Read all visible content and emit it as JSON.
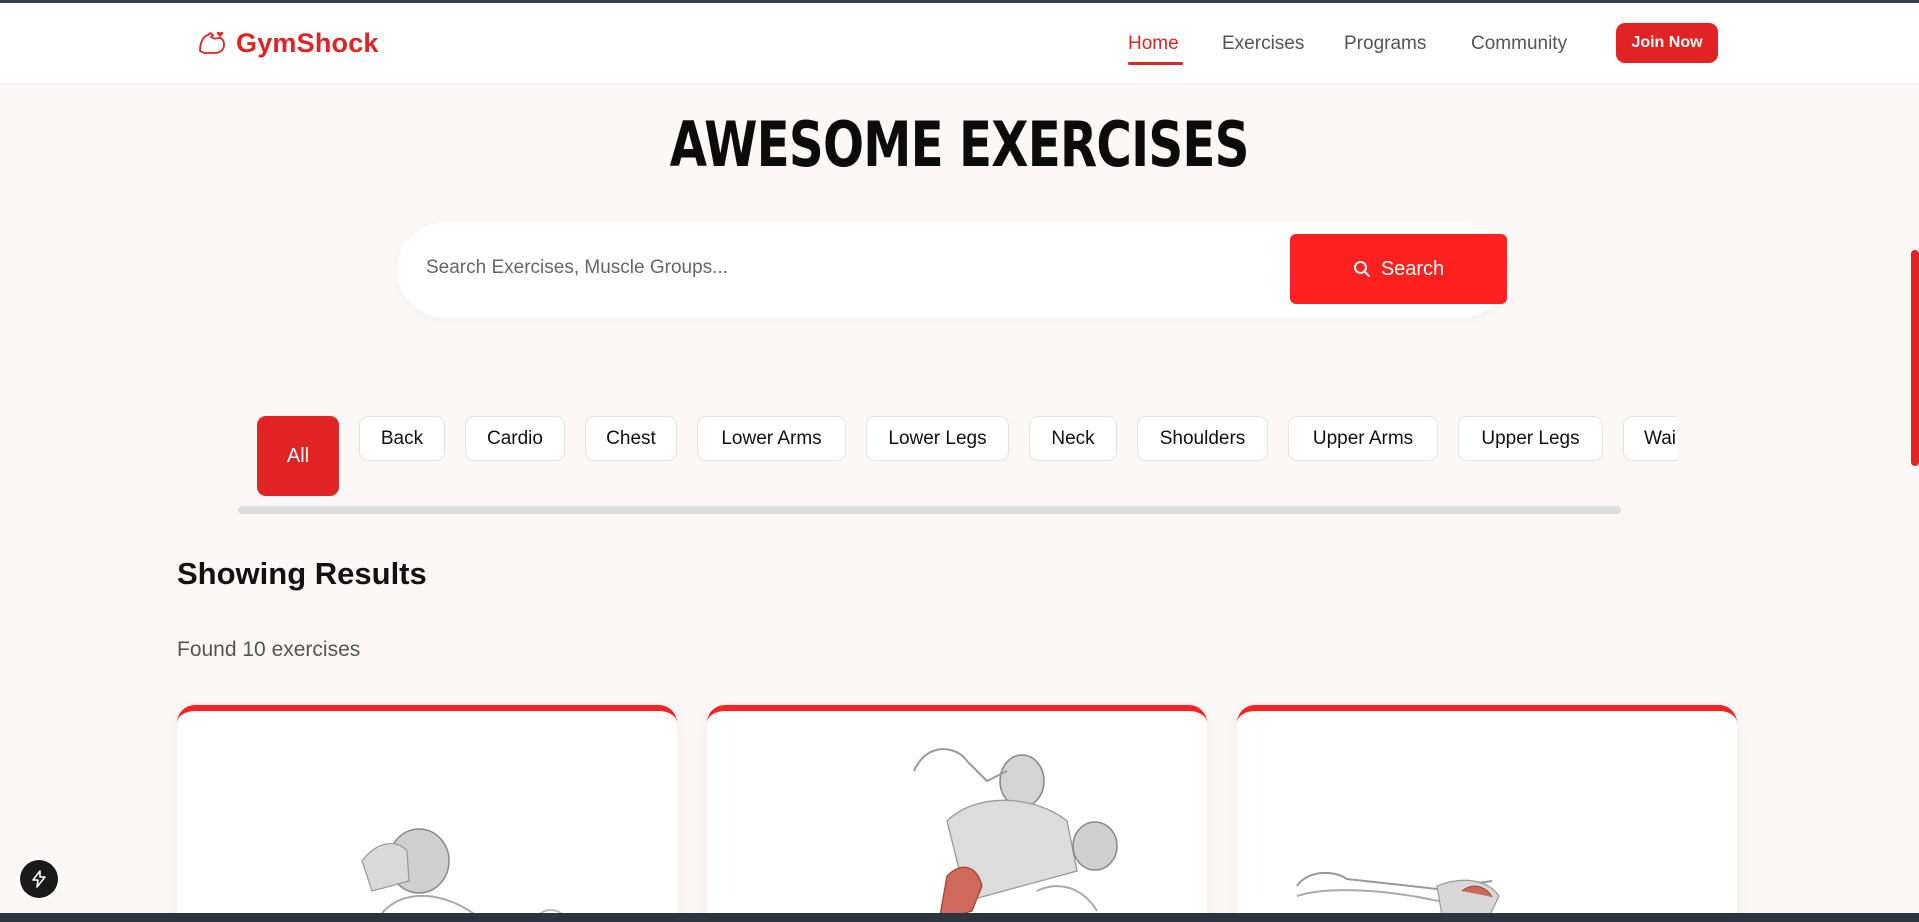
{
  "nav": {
    "brand": "GymShock",
    "links": [
      "Home",
      "Exercises",
      "Programs",
      "Community"
    ],
    "active": "Home",
    "join_label": "Join Now"
  },
  "hero": {
    "title": "AWESOME EXERCISES",
    "search_placeholder": "Search Exercises, Muscle Groups...",
    "search_label": "Search"
  },
  "filters": {
    "selected": "All",
    "items": [
      "Back",
      "Cardio",
      "Chest",
      "Lower Arms",
      "Lower Legs",
      "Neck",
      "Shoulders",
      "Upper Arms",
      "Upper Legs",
      "Wai"
    ]
  },
  "results": {
    "heading": "Showing Results",
    "found": "Found 10 exercises"
  },
  "colors": {
    "accent": "#e02424",
    "search_button": "#ff2020",
    "background": "#fdf8f8"
  },
  "icons": {
    "brand": "flexed-arm-icon",
    "search": "search-icon",
    "floating": "lightning-bolt-icon"
  }
}
